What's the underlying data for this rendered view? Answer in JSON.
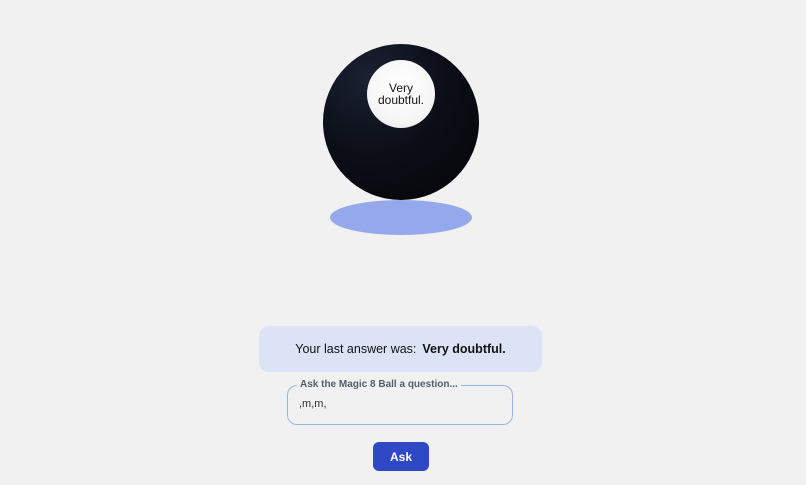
{
  "ball": {
    "answer_line1": "Very",
    "answer_line2": "doubtful.",
    "color": "#030406",
    "shadow_color": "#96a8ec"
  },
  "last_answer": {
    "prefix": "Your last answer was:",
    "value": "Very doubtful."
  },
  "question_field": {
    "label": "Ask the Magic 8 Ball a question...",
    "value": ",m,m,"
  },
  "ask_button": {
    "label": "Ask",
    "color": "#2f48c5"
  }
}
